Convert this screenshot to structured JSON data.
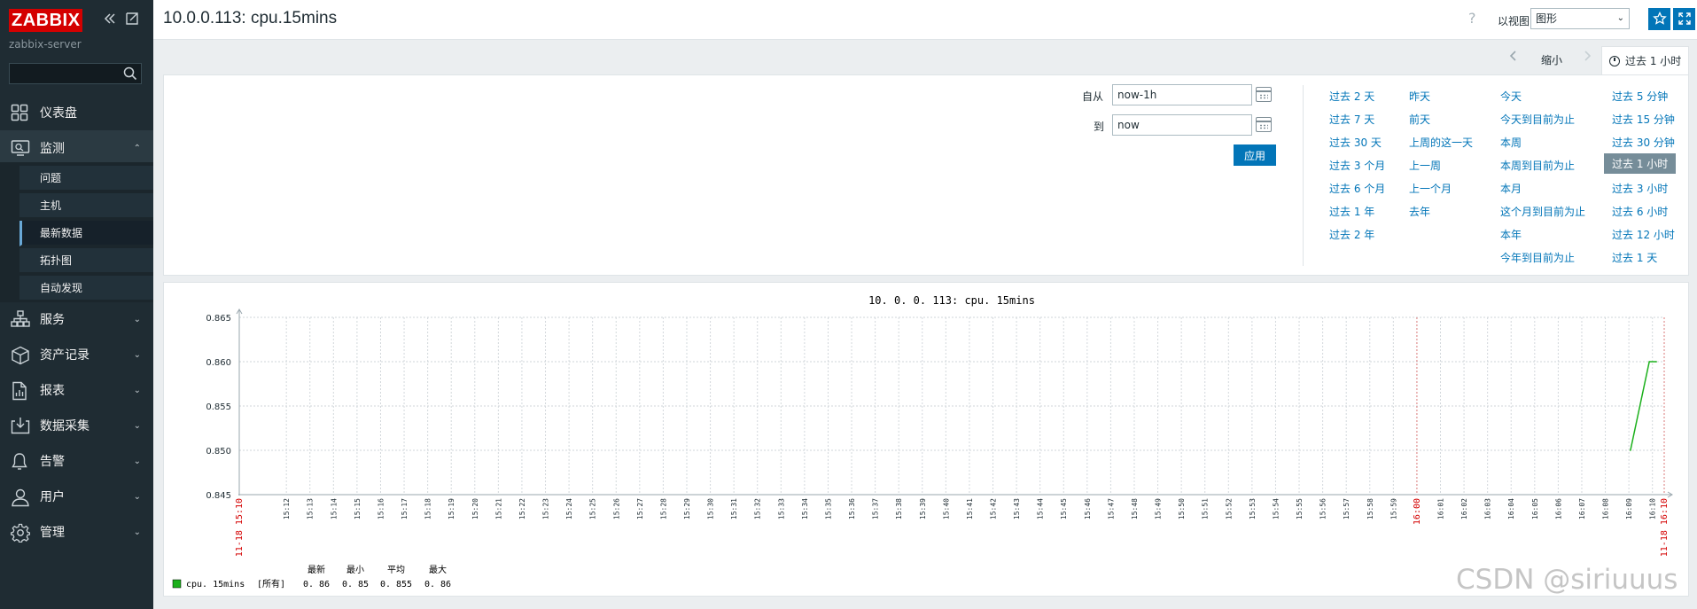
{
  "app": {
    "logo": "ZABBIX",
    "server_name": "zabbix-server",
    "search_placeholder": ""
  },
  "sidebar": {
    "menu": [
      {
        "label": "仪表盘",
        "icon": "dashboard-icon",
        "expandable": false
      },
      {
        "label": "监测",
        "icon": "monitoring-icon",
        "expandable": true,
        "expanded": true
      },
      {
        "label": "服务",
        "icon": "services-icon",
        "expandable": true
      },
      {
        "label": "资产记录",
        "icon": "inventory-icon",
        "expandable": true
      },
      {
        "label": "报表",
        "icon": "reports-icon",
        "expandable": true
      },
      {
        "label": "数据采集",
        "icon": "data-collection-icon",
        "expandable": true
      },
      {
        "label": "告警",
        "icon": "alerts-icon",
        "expandable": true
      },
      {
        "label": "用户",
        "icon": "users-icon",
        "expandable": true
      },
      {
        "label": "管理",
        "icon": "administration-icon",
        "expandable": true
      }
    ],
    "submenu": [
      {
        "label": "问题"
      },
      {
        "label": "主机"
      },
      {
        "label": "最新数据",
        "selected": true
      },
      {
        "label": "拓扑图"
      },
      {
        "label": "自动发现"
      }
    ]
  },
  "header": {
    "title": "10.0.0.113: cpu.15mins",
    "view_as_label": "以视图",
    "view_as_value": "图形"
  },
  "time_tabs": {
    "zoom_out": "缩小",
    "active_tab": "过去 1 小时"
  },
  "filter": {
    "from_label": "自从",
    "from_value": "now-1h",
    "to_label": "到",
    "to_value": "now",
    "apply_label": "应用",
    "quick_ranges": [
      [
        "过去 2 天",
        "过去 7 天",
        "过去 30 天",
        "过去 3 个月",
        "过去 6 个月",
        "过去 1 年",
        "过去 2 年"
      ],
      [
        "昨天",
        "前天",
        "上周的这一天",
        "上一周",
        "上一个月",
        "去年"
      ],
      [
        "今天",
        "今天到目前为止",
        "本周",
        "本周到目前为止",
        "本月",
        "这个月到目前为止",
        "本年",
        "今年到目前为止"
      ],
      [
        "过去 5 分钟",
        "过去 15 分钟",
        "过去 30 分钟",
        "过去 1 小时",
        "过去 3 小时",
        "过去 6 小时",
        "过去 12 小时",
        "过去 1 天"
      ]
    ],
    "selected_range": "过去 1 小时"
  },
  "chart_data": {
    "type": "line",
    "title": "10. 0. 0. 113: cpu. 15mins",
    "y_ticks": [
      "0.845",
      "0.850",
      "0.855",
      "0.860",
      "0.865"
    ],
    "ylim": [
      0.845,
      0.865
    ],
    "x_ticks": [
      "11-18 15:10",
      "15:12",
      "15:13",
      "15:14",
      "15:15",
      "15:16",
      "15:17",
      "15:18",
      "15:19",
      "15:20",
      "15:21",
      "15:22",
      "15:23",
      "15:24",
      "15:25",
      "15:26",
      "15:27",
      "15:28",
      "15:29",
      "15:30",
      "15:31",
      "15:32",
      "15:33",
      "15:34",
      "15:35",
      "15:36",
      "15:37",
      "15:38",
      "15:39",
      "15:40",
      "15:41",
      "15:42",
      "15:43",
      "15:44",
      "15:45",
      "15:46",
      "15:47",
      "15:48",
      "15:49",
      "15:50",
      "15:51",
      "15:52",
      "15:53",
      "15:54",
      "15:55",
      "15:56",
      "15:57",
      "15:58",
      "15:59",
      "16:00",
      "16:01",
      "16:02",
      "16:03",
      "16:04",
      "16:05",
      "16:06",
      "16:07",
      "16:08",
      "16:09",
      "16:10",
      "11-18 16:10"
    ],
    "highlight_ticks": [
      "11-18 15:10",
      "16:00",
      "11-18 16:10"
    ],
    "series": [
      {
        "name": "cpu. 15mins",
        "color": "#1bb01b",
        "points": [
          {
            "x": "16:09:04",
            "y": 0.85
          },
          {
            "x": "16:09:52",
            "y": 0.86
          },
          {
            "x": "16:10:10",
            "y": 0.86
          }
        ]
      }
    ],
    "legend": {
      "headers": [
        "最新",
        "最小",
        "平均",
        "最大"
      ],
      "rows": [
        {
          "name": "cpu. 15mins",
          "func": "[所有]",
          "values": [
            "0. 86",
            "0. 85",
            "0. 855",
            "0. 86"
          ],
          "color": "#1bb01b"
        }
      ]
    }
  },
  "watermark": "CSDN @siriuuus"
}
